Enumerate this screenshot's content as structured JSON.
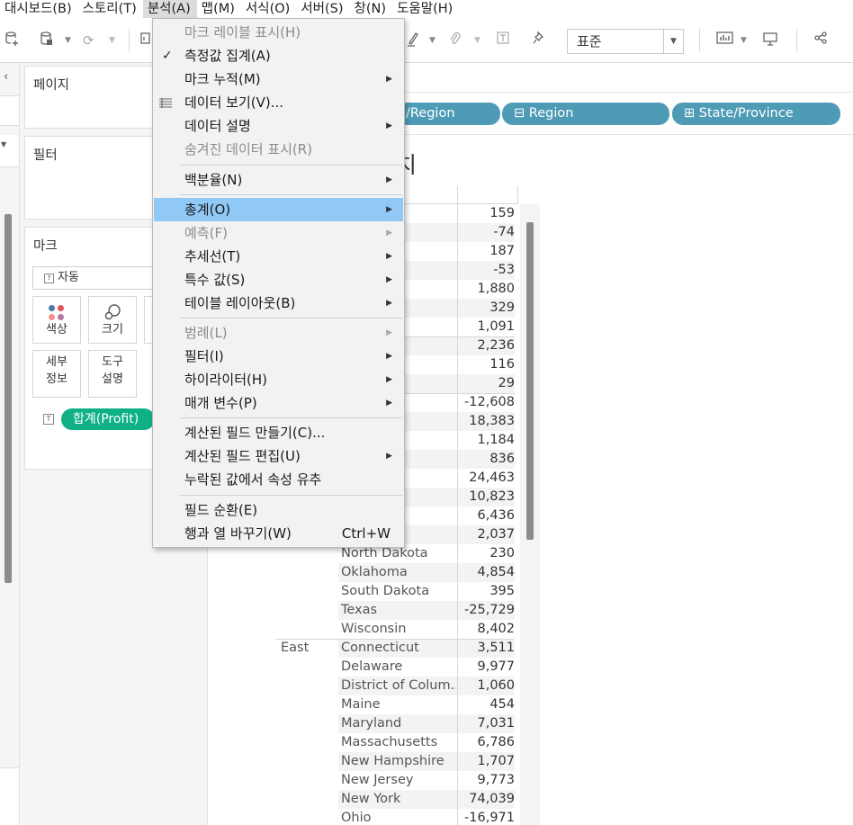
{
  "menubar": {
    "items": [
      "대시보드(B)",
      "스토리(T)",
      "분석(A)",
      "맵(M)",
      "서식(O)",
      "서버(S)",
      "창(N)",
      "도움말(H)"
    ]
  },
  "toolbar": {
    "fit_value": "표준"
  },
  "side": {
    "pages_title": "페이지",
    "filters_title": "필터",
    "marks_title": "마크",
    "mark_type": "자동",
    "mark_buttons": {
      "color": "색상",
      "size": "크기",
      "detail_1": "세부",
      "detail_2": "정보",
      "tooltip_1": "도구",
      "tooltip_2": "설명"
    },
    "measure_pill": "합계(Profit)"
  },
  "rows_shelf": {
    "pills": [
      "/Region",
      "Region",
      "State/Province"
    ]
  },
  "view": {
    "title_fragment": "치",
    "state_header": "vince",
    "rows": [
      {
        "region": "",
        "state": "",
        "value": "159"
      },
      {
        "region": "",
        "state": "swick",
        "value": "-74"
      },
      {
        "region": "",
        "state": "lland a..",
        "value": "187"
      },
      {
        "region": "",
        "state": "ia",
        "value": "-53"
      },
      {
        "region": "",
        "state": "",
        "value": "1,880"
      },
      {
        "region": "",
        "state": "ward Is..",
        "value": "329"
      },
      {
        "region": "",
        "state": "",
        "value": "1,091"
      },
      {
        "region": "",
        "state": "",
        "value": "2,236"
      },
      {
        "region": "",
        "state": "lumbia",
        "value": "116"
      },
      {
        "region": "",
        "state": "wan",
        "value": "29"
      },
      {
        "region": "",
        "state": "",
        "value": "-12,608"
      },
      {
        "region": "",
        "state": "",
        "value": "18,383"
      },
      {
        "region": "",
        "state": "",
        "value": "1,184"
      },
      {
        "region": "",
        "state": "",
        "value": "836"
      },
      {
        "region": "",
        "state": "",
        "value": "24,463"
      },
      {
        "region": "",
        "state": "a",
        "value": "10,823"
      },
      {
        "region": "",
        "state": "",
        "value": "6,436"
      },
      {
        "region": "",
        "state": "",
        "value": "2,037"
      },
      {
        "region": "",
        "state": "North Dakota",
        "value": "230"
      },
      {
        "region": "",
        "state": "Oklahoma",
        "value": "4,854"
      },
      {
        "region": "",
        "state": "South Dakota",
        "value": "395"
      },
      {
        "region": "",
        "state": "Texas",
        "value": "-25,729"
      },
      {
        "region": "",
        "state": "Wisconsin",
        "value": "8,402"
      },
      {
        "region": "East",
        "state": "Connecticut",
        "value": "3,511"
      },
      {
        "region": "",
        "state": "Delaware",
        "value": "9,977"
      },
      {
        "region": "",
        "state": "District of Colum..",
        "value": "1,060"
      },
      {
        "region": "",
        "state": "Maine",
        "value": "454"
      },
      {
        "region": "",
        "state": "Maryland",
        "value": "7,031"
      },
      {
        "region": "",
        "state": "Massachusetts",
        "value": "6,786"
      },
      {
        "region": "",
        "state": "New Hampshire",
        "value": "1,707"
      },
      {
        "region": "",
        "state": "New Jersey",
        "value": "9,773"
      },
      {
        "region": "",
        "state": "New York",
        "value": "74,039"
      },
      {
        "region": "",
        "state": "Ohio",
        "value": "-16,971"
      }
    ]
  },
  "menu": {
    "items": [
      {
        "label": "마크 레이블 표시(H)",
        "disabled": true
      },
      {
        "label": "측정값 집계(A)",
        "checked": true
      },
      {
        "label": "마크 누적(M)",
        "submenu": true
      },
      {
        "label": "데이터 보기(V)...",
        "icon": "grid"
      },
      {
        "label": "데이터 설명",
        "submenu": true
      },
      {
        "label": "숨겨진 데이터 표시(R)",
        "disabled": true
      },
      {
        "label": "백분율(N)",
        "submenu": true
      },
      {
        "label": "총계(O)",
        "submenu": true,
        "highlighted": true
      },
      {
        "label": "예측(F)",
        "submenu": true,
        "disabled": true
      },
      {
        "label": "추세선(T)",
        "submenu": true
      },
      {
        "label": "특수 값(S)",
        "submenu": true
      },
      {
        "label": "테이블 레이아웃(B)",
        "submenu": true
      },
      {
        "label": "범례(L)",
        "submenu": true,
        "disabled": true
      },
      {
        "label": "필터(I)",
        "submenu": true
      },
      {
        "label": "하이라이터(H)",
        "submenu": true
      },
      {
        "label": "매개 변수(P)",
        "submenu": true
      },
      {
        "label": "계산된 필드 만들기(C)..."
      },
      {
        "label": "계산된 필드 편집(U)",
        "submenu": true
      },
      {
        "label": "누락된 값에서 속성 유추"
      },
      {
        "label": "필드 순환(E)"
      },
      {
        "label": "행과 열 바꾸기(W)",
        "shortcut": "Ctrl+W"
      }
    ]
  },
  "colors": {
    "dim_pill": "#4e9bb6",
    "measure_pill": "#10b085",
    "menu_highlight": "#90c8f6"
  }
}
